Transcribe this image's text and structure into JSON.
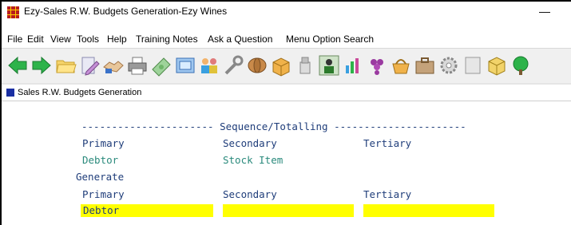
{
  "window": {
    "title": "Ezy-Sales R.W. Budgets Generation-Ezy Wines",
    "minimize_glyph": "—"
  },
  "menu": [
    "File",
    "Edit",
    "View",
    "Tools",
    "Help",
    "Training Notes",
    "Ask a Question",
    "Menu Option Search"
  ],
  "toolbar": {
    "icons": [
      "back-arrow-icon",
      "forward-arrow-icon",
      "folder-icon",
      "edit-document-icon",
      "handshake-icon",
      "printer-icon",
      "money-icon",
      "cash-register-icon",
      "people-icon",
      "wrench-icon",
      "barrel-icon",
      "box-icon",
      "sugar-icon",
      "worker-icon",
      "chart-icon",
      "grapes-icon",
      "basket-icon",
      "briefcase-icon",
      "gear-icon",
      "window-icon",
      "package-icon",
      "tree-icon"
    ]
  },
  "tab": {
    "label": "Sales R.W. Budgets Generation"
  },
  "form": {
    "section_header": "---------------------- Sequence/Totalling ----------------------",
    "primary_label": "Primary",
    "secondary_label": "Secondary",
    "tertiary_label": "Tertiary",
    "primary_value": "Debtor",
    "secondary_value": "Stock Item",
    "generate_label": "Generate",
    "generate_primary_label": "Primary",
    "generate_secondary_label": "Secondary",
    "generate_tertiary_label": "Tertiary",
    "generate_primary_value": "Debtor",
    "generate_secondary_value": "",
    "generate_tertiary_value": ""
  },
  "colors": {
    "label_text": "#1f3d7a",
    "value_text": "#2a8a7c",
    "field_highlight": "#ffff00"
  }
}
